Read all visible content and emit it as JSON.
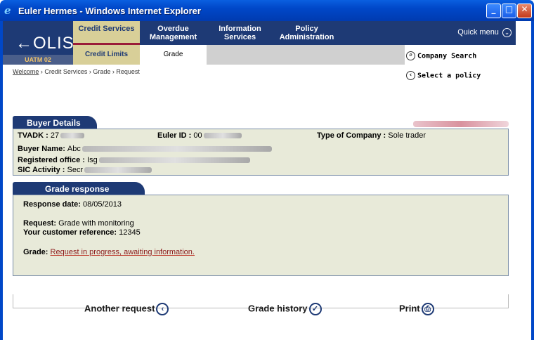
{
  "window": {
    "title": "Euler Hermes - Windows Internet Explorer"
  },
  "app": {
    "logo": "←OLIS",
    "logo_sub": "UATM 02",
    "nav": [
      {
        "label": "Credit Services",
        "active": true
      },
      {
        "label": "Overdue Management",
        "active": false
      },
      {
        "label": "Information Services",
        "active": false
      },
      {
        "label": "Policy Administration",
        "active": false
      }
    ],
    "quick_menu": "Quick menu",
    "subnav": [
      {
        "label": "Credit Limits"
      },
      {
        "label": "Grade"
      }
    ],
    "company_search": "Company Search",
    "select_policy": "Select a policy"
  },
  "breadcrumb": {
    "first": "Welcome",
    "rest": " › Credit Services › Grade › Request"
  },
  "buyer": {
    "tab": "Buyer Details",
    "tvadk_label": "TVADK :",
    "tvadk_value": "27",
    "euler_id_label": "Euler ID :",
    "euler_id_value": "00",
    "company_type_label": "Type of Company :",
    "company_type_value": "Sole trader",
    "name_label": "Buyer Name:",
    "name_value": "Abc",
    "office_label": "Registered office :",
    "office_value": "Isg",
    "sic_label": "SIC Activity :",
    "sic_value": "Secr"
  },
  "grade": {
    "tab": "Grade response",
    "response_date_label": "Response date:",
    "response_date_value": "08/05/2013",
    "request_label": "Request:",
    "request_value": "Grade with monitoring",
    "reference_label": "Your customer reference:",
    "reference_value": "12345",
    "grade_label": "Grade:",
    "grade_value": "Request in progress, awaiting information."
  },
  "actions": {
    "another_request": "Another request",
    "grade_history": "Grade history",
    "print": "Print"
  },
  "colors": {
    "navy": "#1e3a75",
    "gold": "#d8cf98",
    "panel": "#e8ead9"
  }
}
